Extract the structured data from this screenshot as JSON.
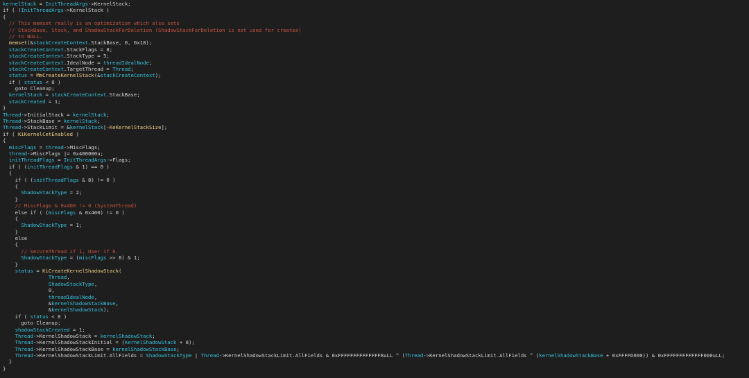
{
  "colors": {
    "background": "#1e1e1e",
    "plain": "#d4d4d4",
    "variable": "#35c4e0",
    "comment": "#c8543e",
    "function": "#f0cf87"
  },
  "code_lines": [
    [
      [
        "v",
        "kernelStack"
      ],
      [
        "t",
        " = "
      ],
      [
        "v",
        "InitThreadArgs"
      ],
      [
        "t",
        "->KernelStack;"
      ]
    ],
    [
      [
        "t",
        "if ( !"
      ],
      [
        "v",
        "InitThreadArgs"
      ],
      [
        "t",
        "->KernelStack )"
      ]
    ],
    [
      [
        "t",
        "{"
      ]
    ],
    [
      [
        "c",
        "  // This memset really is an optimization which also sets"
      ]
    ],
    [
      [
        "c",
        "  // StackBase, Stack, and ShadowStackForDeletion (ShadowStackForDeletion is not used for creates)"
      ]
    ],
    [
      [
        "c",
        "  // to NULL."
      ]
    ],
    [
      [
        "t",
        "  "
      ],
      [
        "f",
        "memset"
      ],
      [
        "t",
        "(&"
      ],
      [
        "v",
        "stackCreateContext"
      ],
      [
        "t",
        ".StackBase, 0, 0x18);"
      ]
    ],
    [
      [
        "t",
        "  "
      ],
      [
        "v",
        "stackCreateContext"
      ],
      [
        "t",
        ".StackFlags = 8;"
      ]
    ],
    [
      [
        "t",
        "  "
      ],
      [
        "v",
        "stackCreateContext"
      ],
      [
        "t",
        ".StackType = 5;"
      ]
    ],
    [
      [
        "t",
        "  "
      ],
      [
        "v",
        "stackCreateContext"
      ],
      [
        "t",
        ".IdealNode = "
      ],
      [
        "v",
        "threadIdealNode"
      ],
      [
        "t",
        ";"
      ]
    ],
    [
      [
        "t",
        "  "
      ],
      [
        "v",
        "stackCreateContext"
      ],
      [
        "t",
        ".TargetThread = "
      ],
      [
        "v",
        "Thread"
      ],
      [
        "t",
        ";"
      ]
    ],
    [
      [
        "t",
        "  "
      ],
      [
        "v",
        "status"
      ],
      [
        "t",
        " = "
      ],
      [
        "f",
        "MmCreateKernelStack"
      ],
      [
        "t",
        "(&"
      ],
      [
        "v",
        "stackCreateContext"
      ],
      [
        "t",
        ");"
      ]
    ],
    [
      [
        "t",
        "  if ( "
      ],
      [
        "v",
        "status"
      ],
      [
        "t",
        " < 0 )"
      ]
    ],
    [
      [
        "t",
        "    goto Cleanup;"
      ]
    ],
    [
      [
        "t",
        "  "
      ],
      [
        "v",
        "kernelStack"
      ],
      [
        "t",
        " = "
      ],
      [
        "v",
        "stackCreateContext"
      ],
      [
        "t",
        ".StackBase;"
      ]
    ],
    [
      [
        "t",
        "  "
      ],
      [
        "v",
        "stackCreated"
      ],
      [
        "t",
        " = 1;"
      ]
    ],
    [
      [
        "t",
        "}"
      ]
    ],
    [
      [
        "v",
        "Thread"
      ],
      [
        "t",
        "->InitialStack = "
      ],
      [
        "v",
        "kernelStack"
      ],
      [
        "t",
        ";"
      ]
    ],
    [
      [
        "v",
        "Thread"
      ],
      [
        "t",
        "->StackBase = "
      ],
      [
        "v",
        "kernelStack"
      ],
      [
        "t",
        ";"
      ]
    ],
    [
      [
        "v",
        "Thread"
      ],
      [
        "t",
        "->StackLimit = &"
      ],
      [
        "v",
        "kernelStack"
      ],
      [
        "t",
        "[-"
      ],
      [
        "f",
        "KeKernelStackSize"
      ],
      [
        "t",
        "];"
      ]
    ],
    [
      [
        "t",
        "if ( "
      ],
      [
        "f",
        "KiKernelCetEnabled"
      ],
      [
        "t",
        " )"
      ]
    ],
    [
      [
        "t",
        "{"
      ]
    ],
    [
      [
        "t",
        "  "
      ],
      [
        "v",
        "miscFlags"
      ],
      [
        "t",
        " = "
      ],
      [
        "v",
        "thread"
      ],
      [
        "t",
        "->MiscFlags;"
      ]
    ],
    [
      [
        "t",
        "  "
      ],
      [
        "v",
        "thread"
      ],
      [
        "t",
        "->MiscFlags |= 0x400000u;"
      ]
    ],
    [
      [
        "t",
        "  "
      ],
      [
        "v",
        "initThreadFlags"
      ],
      [
        "t",
        " = "
      ],
      [
        "v",
        "InitThreadArgs"
      ],
      [
        "t",
        "->Flags;"
      ]
    ],
    [
      [
        "t",
        "  if ( ("
      ],
      [
        "v",
        "initThreadFlags"
      ],
      [
        "t",
        " & 1) == 0 )"
      ]
    ],
    [
      [
        "t",
        "  {"
      ]
    ],
    [
      [
        "t",
        "    if ( ("
      ],
      [
        "v",
        "initThreadFlags"
      ],
      [
        "t",
        " & 8) != 0 )"
      ]
    ],
    [
      [
        "t",
        "    {"
      ]
    ],
    [
      [
        "t",
        "      "
      ],
      [
        "v",
        "ShadowStackType"
      ],
      [
        "t",
        " = 2;"
      ]
    ],
    [
      [
        "t",
        "    }"
      ]
    ],
    [
      [
        "c",
        "    // MiscFlags & 0x400 != 0 (SystemThread)"
      ]
    ],
    [
      [
        "t",
        "    else if ( ("
      ],
      [
        "v",
        "miscFlags"
      ],
      [
        "t",
        " & 0x400) != 0 )"
      ]
    ],
    [
      [
        "t",
        "    {"
      ]
    ],
    [
      [
        "t",
        "      "
      ],
      [
        "v",
        "ShadowStackType"
      ],
      [
        "t",
        " = 1;"
      ]
    ],
    [
      [
        "t",
        "    }"
      ]
    ],
    [
      [
        "t",
        "    else"
      ]
    ],
    [
      [
        "t",
        "    {"
      ]
    ],
    [
      [
        "c",
        "      // SecureThread if 1, User if 0."
      ]
    ],
    [
      [
        "t",
        "      "
      ],
      [
        "v",
        "ShadowStackType"
      ],
      [
        "t",
        " = ("
      ],
      [
        "v",
        "miscFlags"
      ],
      [
        "t",
        " >> 8) & 1;"
      ]
    ],
    [
      [
        "t",
        "    }"
      ]
    ],
    [
      [
        "t",
        "    "
      ],
      [
        "v",
        "status"
      ],
      [
        "t",
        " = "
      ],
      [
        "f",
        "KiCreateKernelShadowStack"
      ],
      [
        "t",
        "("
      ]
    ],
    [
      [
        "t",
        "               "
      ],
      [
        "v",
        "Thread"
      ],
      [
        "t",
        ","
      ]
    ],
    [
      [
        "t",
        "               "
      ],
      [
        "v",
        "ShadowStackType"
      ],
      [
        "t",
        ","
      ]
    ],
    [
      [
        "t",
        "               0,"
      ]
    ],
    [
      [
        "t",
        "               "
      ],
      [
        "v",
        "threadIdealNode"
      ],
      [
        "t",
        ","
      ]
    ],
    [
      [
        "t",
        "               &"
      ],
      [
        "v",
        "kernelShadowStackBase"
      ],
      [
        "t",
        ","
      ]
    ],
    [
      [
        "t",
        "               &"
      ],
      [
        "v",
        "kernelShadowStack"
      ],
      [
        "t",
        ");"
      ]
    ],
    [
      [
        "t",
        "    if ( "
      ],
      [
        "v",
        "status"
      ],
      [
        "t",
        " < 0 )"
      ]
    ],
    [
      [
        "t",
        "      goto Cleanup;"
      ]
    ],
    [
      [
        "t",
        "    "
      ],
      [
        "v",
        "shadowStackCreated"
      ],
      [
        "t",
        " = 1;"
      ]
    ],
    [
      [
        "t",
        "    "
      ],
      [
        "v",
        "Thread"
      ],
      [
        "t",
        "->KernelShadowStack = "
      ],
      [
        "v",
        "kernelShadowStack"
      ],
      [
        "t",
        ";"
      ]
    ],
    [
      [
        "t",
        "    "
      ],
      [
        "v",
        "Thread"
      ],
      [
        "t",
        "->KernelShadowStackInitial = ("
      ],
      [
        "v",
        "kernelShadowStack"
      ],
      [
        "t",
        " + 8);"
      ]
    ],
    [
      [
        "t",
        "    "
      ],
      [
        "v",
        "Thread"
      ],
      [
        "t",
        "->KernelShadowStackBase = "
      ],
      [
        "v",
        "kernelShadowStackBase"
      ],
      [
        "t",
        ";"
      ]
    ],
    [
      [
        "t",
        "    "
      ],
      [
        "v",
        "Thread"
      ],
      [
        "t",
        "->KernelShadowStackLimit.AllFields = "
      ],
      [
        "v",
        "ShadowStackType"
      ],
      [
        "t",
        " | "
      ],
      [
        "v",
        "Thread"
      ],
      [
        "t",
        "->KernelShadowStackLimit.AllFields & 0xFFFFFFFFFFFFFF8uLL ^ ("
      ],
      [
        "v",
        "Thread"
      ],
      [
        "t",
        "->KernelShadowStackLimit.AllFields ^ ("
      ],
      [
        "v",
        "kernelShadowStackBase"
      ],
      [
        "t",
        " + 0xFFFFD000)) & 0xFFFFFFFFFFFFF000uLL;"
      ]
    ],
    [
      [
        "t",
        "  }"
      ]
    ],
    [
      [
        "t",
        "}"
      ]
    ]
  ]
}
